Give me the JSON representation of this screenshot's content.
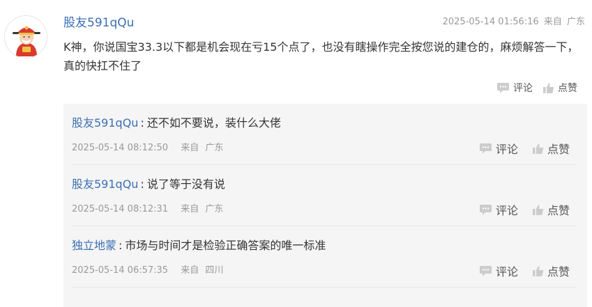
{
  "comment": {
    "author": "股友591qQu",
    "timestamp": "2025-05-14 01:56:16",
    "from_label": "来自",
    "location": "广东",
    "text": "K神，你说国宝33.3以下都是机会现在亏15个点了，也没有瞎操作完全按您说的建仓的，麻烦解答一下，真的快扛不住了",
    "comment_label": "评论",
    "like_label": "点赞"
  },
  "replies": [
    {
      "user": "股友591qQu",
      "text": "还不如不要说，装什么大佬",
      "time": "2025-05-14 08:12:50",
      "from_label": "来自",
      "location": "广东",
      "comment_label": "评论",
      "like_label": "点赞"
    },
    {
      "user": "股友591qQu",
      "text": "说了等于没有说",
      "time": "2025-05-14 08:12:31",
      "from_label": "来自",
      "location": "广东",
      "comment_label": "评论",
      "like_label": "点赞"
    },
    {
      "user": "独立地蒙",
      "text": "市场与时间才是检验正确答案的唯一标准",
      "time": "2025-05-14 06:57:35",
      "from_label": "来自",
      "location": "四川",
      "comment_label": "评论",
      "like_label": "点赞"
    }
  ],
  "colors": {
    "link": "#3a6fb5",
    "meta": "#999999",
    "reply_bg": "#f5f5f5",
    "icon": "#cccccc"
  },
  "icons": {
    "comment": "speech-bubble-icon",
    "like": "thumbs-up-icon",
    "avatar": "god-of-wealth-avatar"
  }
}
